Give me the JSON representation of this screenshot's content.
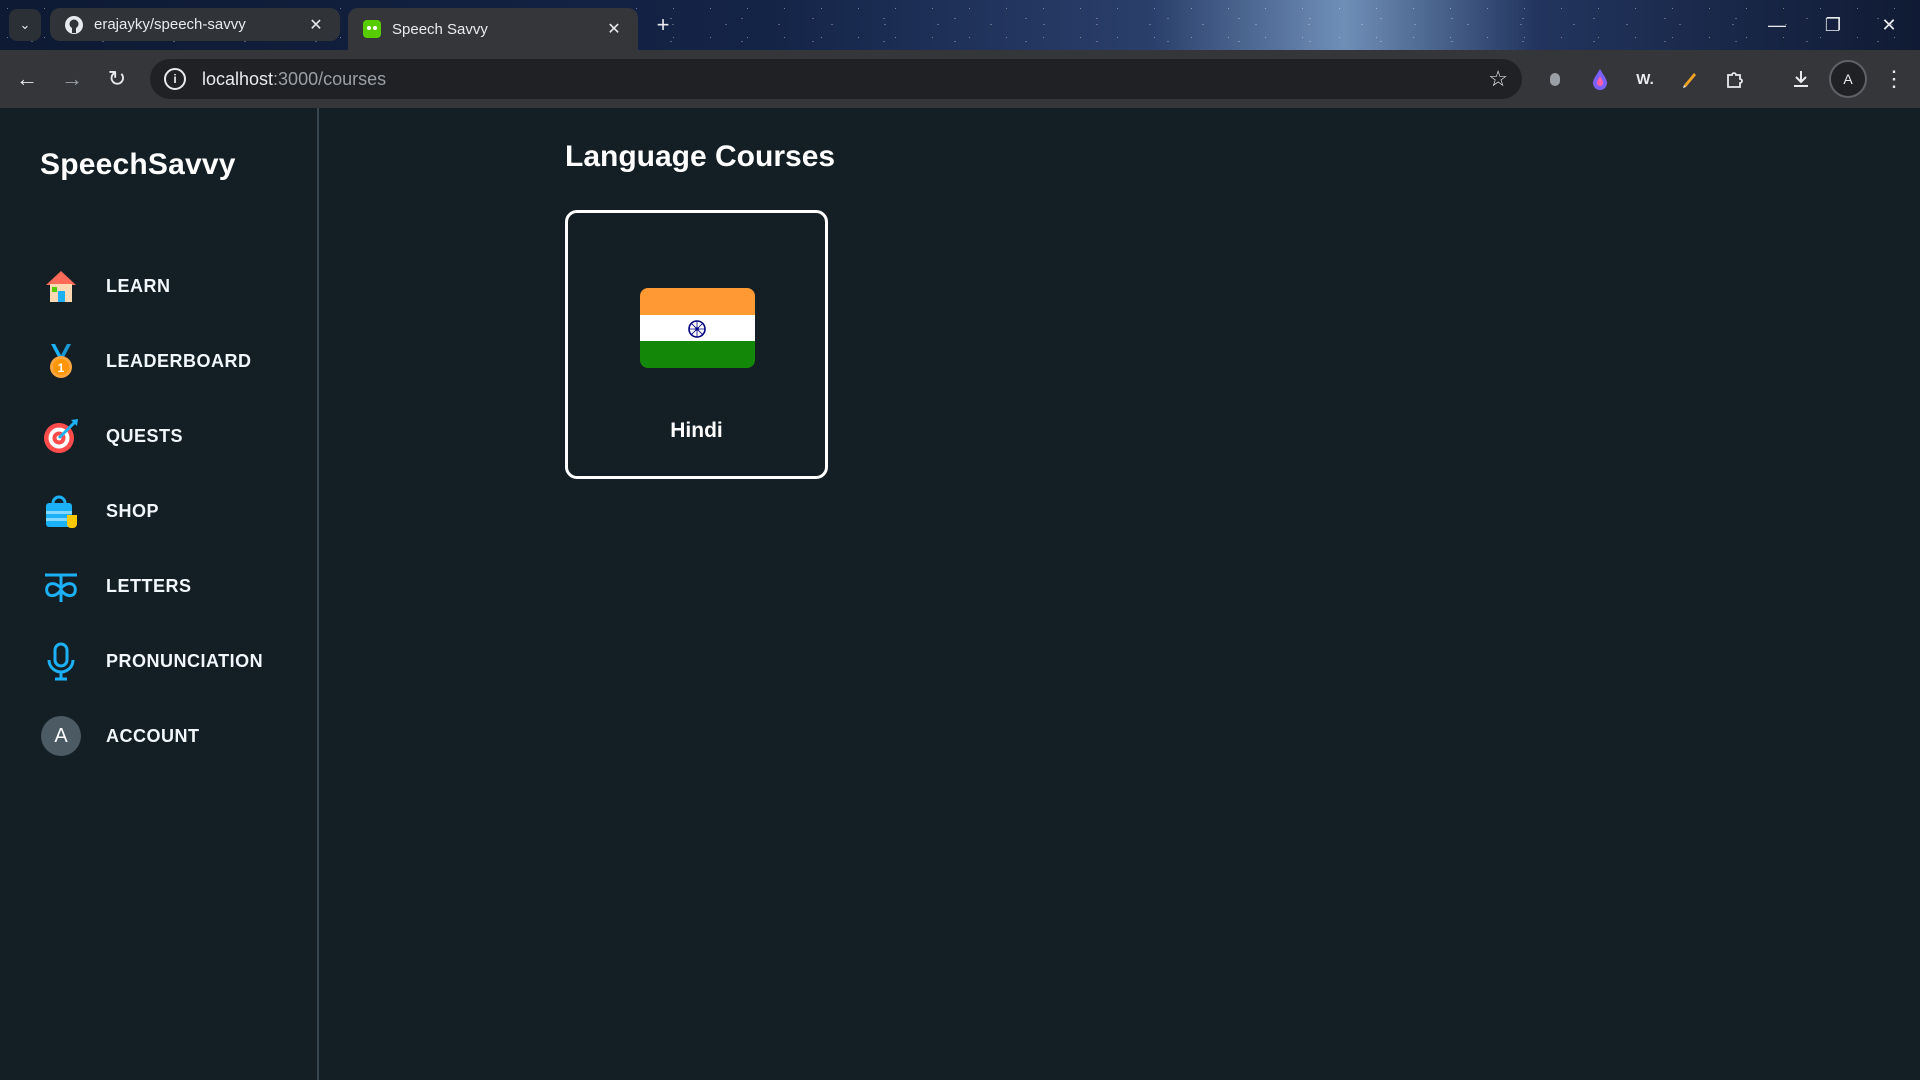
{
  "browser": {
    "tabs": [
      {
        "title": "erajayky/speech-savvy",
        "favicon": "github-icon",
        "active": false
      },
      {
        "title": "Speech Savvy",
        "favicon": "speech-savvy-favicon",
        "active": true
      }
    ],
    "url_host": "localhost",
    "url_path": ":3000/courses",
    "profile_initial": "A"
  },
  "sidebar": {
    "logo": "SpeechSavvy",
    "items": [
      {
        "label": "LEARN",
        "icon": "house-icon"
      },
      {
        "label": "LEADERBOARD",
        "icon": "medal-icon"
      },
      {
        "label": "QUESTS",
        "icon": "target-icon"
      },
      {
        "label": "SHOP",
        "icon": "shopping-bag-icon"
      },
      {
        "label": "LETTERS",
        "icon": "devanagari-letter-icon"
      },
      {
        "label": "PRONUNCIATION",
        "icon": "microphone-icon"
      },
      {
        "label": "ACCOUNT",
        "icon": "avatar-icon",
        "avatar_initial": "A"
      }
    ]
  },
  "main": {
    "title": "Language Courses",
    "courses": [
      {
        "name": "Hindi",
        "flag": "india-flag",
        "colors": [
          "#ff9933",
          "#ffffff",
          "#138808"
        ],
        "chakra_color": "#000080"
      }
    ]
  },
  "theme": {
    "background": "#131f24",
    "border": "#37464f",
    "accent": "#1cb0f6"
  }
}
